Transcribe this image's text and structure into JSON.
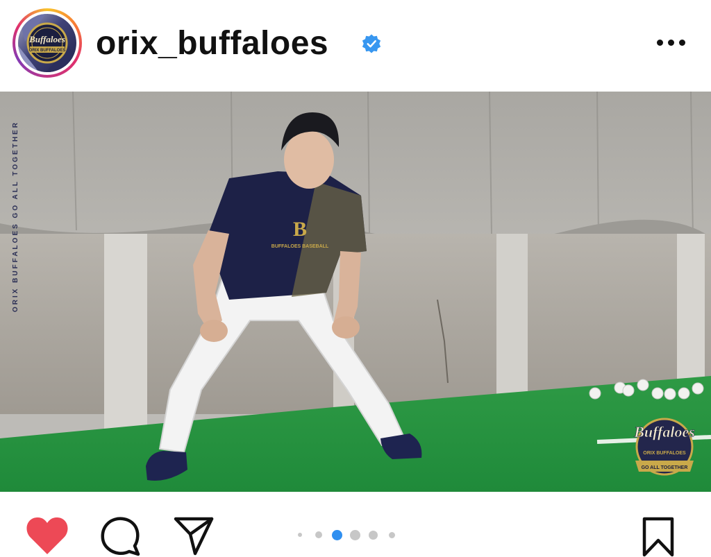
{
  "post": {
    "username": "orix_buffaloes",
    "verified": true,
    "more_icon": "more-horizontal-icon"
  },
  "avatar": {
    "logo_text": "Buffaloes",
    "logo_subtext": "ORIX BUFFALOES"
  },
  "photo": {
    "side_text": "ORIX BUFFALOES  GO ALL TOGETHER",
    "shirt_text": "BUFFALOES BASEBALL",
    "watermark_logo": "Buffaloes",
    "watermark_sub": "ORIX BUFFALOES",
    "watermark_ribbon": "GO ALL TOGETHER"
  },
  "actions": {
    "like_icon": "heart-filled-icon",
    "comment_icon": "comment-icon",
    "share_icon": "send-icon",
    "save_icon": "bookmark-icon",
    "liked_color": "#ed4956"
  },
  "carousel": {
    "total_visible_dots": 6,
    "active_index": 2,
    "active_color": "#2f8ff0"
  }
}
